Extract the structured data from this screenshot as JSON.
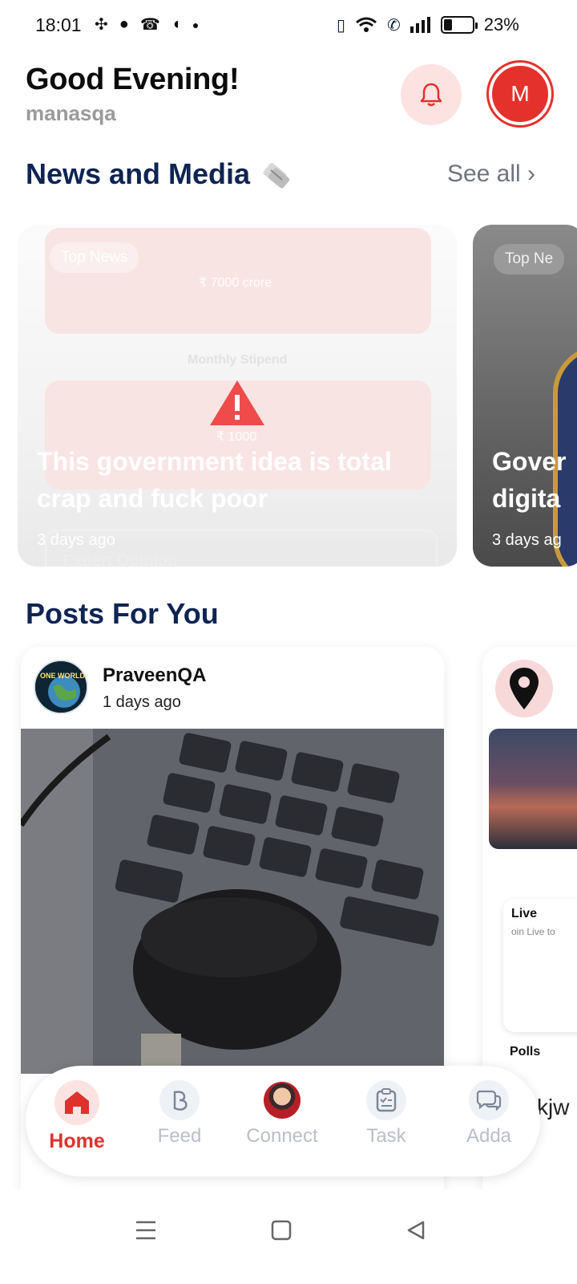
{
  "status_bar": {
    "time": "18:01",
    "battery_percent": "23%",
    "battery_level": 0.23,
    "left_icons": [
      "slack-icon",
      "chat-icon",
      "missed-call-icon",
      "app-icon",
      "dot-icon"
    ],
    "right_icons": [
      "vibrate-icon",
      "wifi-icon",
      "wifi-call-icon",
      "signal-icon",
      "battery-icon"
    ]
  },
  "header": {
    "greeting": "Good Evening!",
    "username": "manasqa",
    "avatar_initial": "M"
  },
  "news": {
    "title": "News and Media",
    "see_all": "See all ›",
    "cards": [
      {
        "chip": "Top News",
        "headline": "This government idea is total crap and fuck poor",
        "time": "3 days ago",
        "faint_amount_1": "₹ 7000 crore",
        "faint_label": "Monthly Stipend",
        "faint_amount_2": "₹ 1000",
        "faint_expert": "Expert Opinion"
      },
      {
        "chip": "Top Ne",
        "headline": "Gover\ndigita",
        "time": "3 days ag"
      }
    ]
  },
  "posts": {
    "title": "Posts For You",
    "items": [
      {
        "author": "PraveenQA",
        "time": "1 days ago",
        "avatar_text": "ONE WORLD"
      },
      {
        "live_title": "Live",
        "live_sub": "oin Live to",
        "polls_title": "Polls"
      }
    ]
  },
  "bottom_nav": {
    "items": [
      {
        "label": "Home",
        "icon": "home-icon",
        "active": true
      },
      {
        "label": "Feed",
        "icon": "feed-icon",
        "active": false
      },
      {
        "label": "Connect",
        "icon": "connect-photo",
        "active": false
      },
      {
        "label": "Task",
        "icon": "task-icon",
        "active": false
      },
      {
        "label": "Adda",
        "icon": "chat-bubbles-icon",
        "active": false
      }
    ],
    "peek_text": "kjw"
  },
  "colors": {
    "accent_red": "#e0322c",
    "navy": "#0e2453",
    "pink_bg": "#fde2e2"
  }
}
